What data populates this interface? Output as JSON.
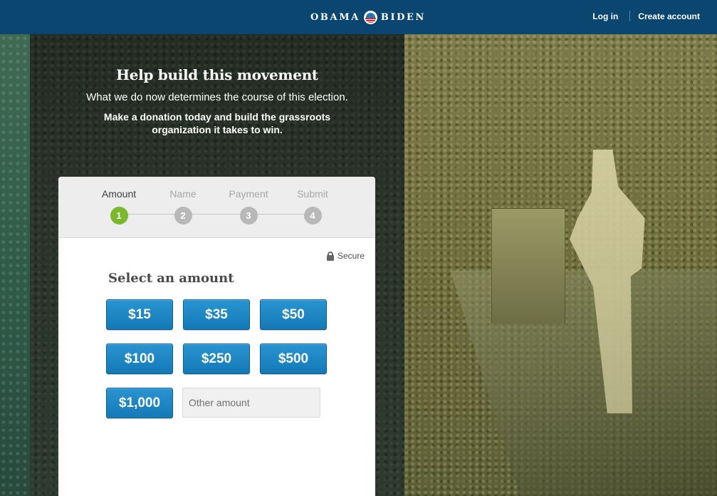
{
  "header": {
    "logo_left": "OBAMA",
    "logo_right": "BIDEN",
    "logo_icon": "campaign-o-logo-icon",
    "login_label": "Log in",
    "create_account_label": "Create account",
    "bg_color": "#0b4670"
  },
  "hero": {
    "title": "Help build this movement",
    "subtitle": "What we do now determines the course of this election.",
    "cta": "Make a donation today and build the grassroots organization it takes to win."
  },
  "steps": [
    {
      "label": "Amount",
      "number": "1",
      "active": true
    },
    {
      "label": "Name",
      "number": "2",
      "active": false
    },
    {
      "label": "Payment",
      "number": "3",
      "active": false
    },
    {
      "label": "Submit",
      "number": "4",
      "active": false
    }
  ],
  "form": {
    "secure_label": "Secure",
    "secure_icon": "lock-icon",
    "title": "Select an amount",
    "amounts": [
      "$15",
      "$35",
      "$50",
      "$100",
      "$250",
      "$500",
      "$1,000"
    ],
    "other_placeholder": "Other amount",
    "other_value": ""
  },
  "colors": {
    "accent_blue": "#1c84c6",
    "active_step_green": "#7ab92c",
    "inactive_step_gray": "#b8b8b8"
  }
}
